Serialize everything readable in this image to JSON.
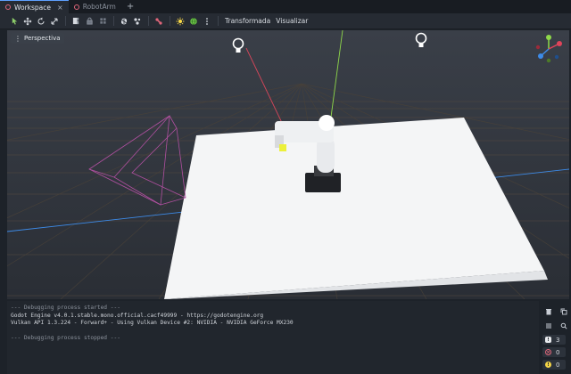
{
  "tabs": [
    {
      "label": "Workspace",
      "active": true,
      "close": "×"
    },
    {
      "label": "RobotArm",
      "active": false
    }
  ],
  "add_tab": "+",
  "toolbar": {
    "icons": [
      "select-icon",
      "move-icon",
      "rotate-icon",
      "scale-icon",
      "list-select-icon",
      "lock-icon",
      "group-icon",
      "snap-icon",
      "local-space-icon",
      "bone-icon",
      "sun-icon",
      "environment-icon",
      "more-icon"
    ],
    "transform_label": "Transformada",
    "view_label": "Visualizar"
  },
  "viewport": {
    "perspective_label": "Perspectiva",
    "gizmo_axes": [
      "x",
      "y",
      "z"
    ]
  },
  "output": {
    "lines": [
      {
        "text": "--- Debugging process started ---",
        "dim": true
      },
      {
        "text": "Godot Engine v4.0.1.stable.mono.official.cacf49999 - https://godotengine.org",
        "dim": false
      },
      {
        "text": "Vulkan API 1.3.224 - Forward+ - Using Vulkan Device #2: NVIDIA - NVIDIA GeForce MX230",
        "dim": false
      },
      {
        "text": "",
        "dim": false
      },
      {
        "text": "--- Debugging process stopped ---",
        "dim": true
      }
    ]
  },
  "filters": {
    "messages_count": "3",
    "errors_count": "0",
    "warnings_count": "0"
  },
  "colors": {
    "accent": "#5ea0ff",
    "error": "#e0667a",
    "warning": "#f5d547",
    "x_axis": "#e0445a",
    "y_axis": "#8fd94a",
    "z_axis": "#3d8be8"
  }
}
